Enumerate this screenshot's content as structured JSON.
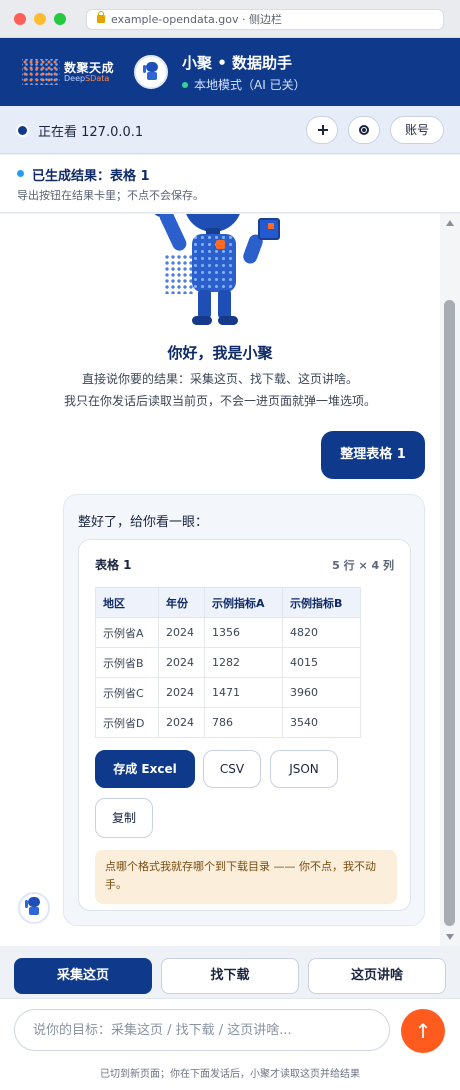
{
  "browser": {
    "url": "example-opendata.gov · 侧边栏"
  },
  "header": {
    "brand_cn": "数聚天成",
    "brand_en_a": "Deep",
    "brand_en_b": "SData",
    "title": "小聚 • 数据助手",
    "status": "本地模式（AI 已关）"
  },
  "watchbar": {
    "text": "正在看 127.0.0.1",
    "add_icon": "plus-icon",
    "settings_icon": "gear-icon",
    "account_label": "账号"
  },
  "generated": {
    "title": "已生成结果：表格 1",
    "subtitle": "导出按钮在结果卡里；不点不会保存。"
  },
  "intro": {
    "title": "你好，我是小聚",
    "line1": "直接说你要的结果：采集这页、找下载、这页讲啥。",
    "line2": "我只在你发话后读取当前页，不会一进页面就弹一堆选项。"
  },
  "user_message": "整理表格 1",
  "bot_message": {
    "greeting": "整好了，给你看一眼：",
    "card": {
      "title": "表格 1",
      "meta": "5 行 × 4 列",
      "columns": [
        "地区",
        "年份",
        "示例指标A",
        "示例指标B"
      ],
      "rows": [
        [
          "示例省A",
          "2024",
          "1356",
          "4820"
        ],
        [
          "示例省B",
          "2024",
          "1282",
          "4015"
        ],
        [
          "示例省C",
          "2024",
          "1471",
          "3960"
        ],
        [
          "示例省D",
          "2024",
          "786",
          "3540"
        ]
      ],
      "buttons": {
        "excel": "存成 Excel",
        "csv": "CSV",
        "json": "JSON",
        "copy": "复制"
      },
      "hint": "点哪个格式我就存哪个到下载目录 —— 你不点，我不动手。"
    }
  },
  "actions": [
    "采集这页",
    "找下载",
    "这页讲啥"
  ],
  "input": {
    "placeholder": "说你的目标：采集这页 / 找下载 / 这页讲啥...",
    "send_glyph": "↑"
  },
  "footnote": "已切到新页面；你在下面发话后，小聚才读取这页并给结果",
  "colors": {
    "primary": "#0f3a8c",
    "accent": "#ff5b1f",
    "status_ok": "#34d399"
  }
}
